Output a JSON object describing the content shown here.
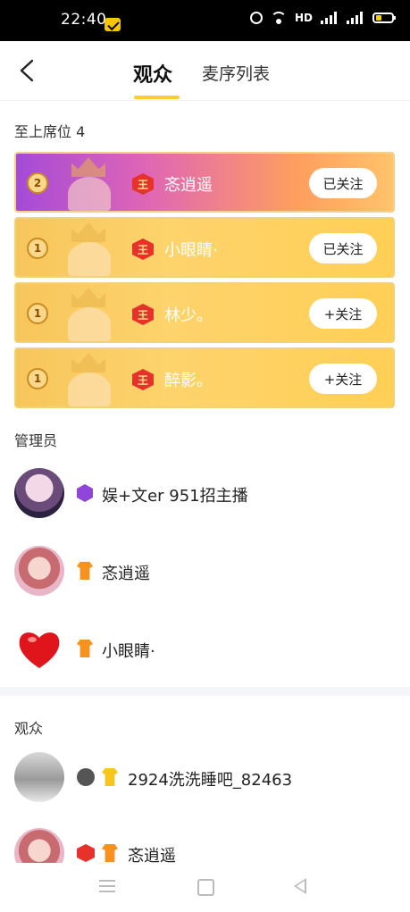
{
  "status_bar": {
    "time": "22:40",
    "network": "HD",
    "sig1": "4G",
    "sig2": "4G"
  },
  "header": {
    "tabs": [
      {
        "label": "观众",
        "active": true
      },
      {
        "label": "麦序列表",
        "active": false
      }
    ]
  },
  "vip_section": {
    "title": "至上席位  4",
    "cards": [
      {
        "rank": "2",
        "name": "忞逍遥",
        "follow": "已关注",
        "theme": "purple"
      },
      {
        "rank": "1",
        "name": "小眼睛·",
        "follow": "已关注",
        "theme": "gold"
      },
      {
        "rank": "1",
        "name": "林少。",
        "follow": "+关注",
        "theme": "gold"
      },
      {
        "rank": "1",
        "name": "醉影。",
        "follow": "+关注",
        "theme": "gold"
      }
    ],
    "king_glyph": "王"
  },
  "admin_section": {
    "title": "管理员",
    "users": [
      {
        "name": "娱+文er 951招主播",
        "badge": "purple-shield-icon"
      },
      {
        "name": "忞逍遥",
        "badge": "orange-shirt-icon"
      },
      {
        "name": "小眼睛·",
        "badge": "orange-shirt-icon"
      }
    ]
  },
  "audience_section": {
    "title": "观众",
    "users": [
      {
        "name": "2924洗洗睡吧_82463",
        "badges": [
          "level-icon",
          "yellow-shirt-icon"
        ]
      },
      {
        "name": "忞逍遥",
        "badges": [
          "king-badge-icon",
          "orange-shirt-icon"
        ]
      }
    ]
  },
  "colors": {
    "accent": "#ffcc33",
    "gold_card": "#fdd36c",
    "purple_card": "#a54ad8"
  }
}
